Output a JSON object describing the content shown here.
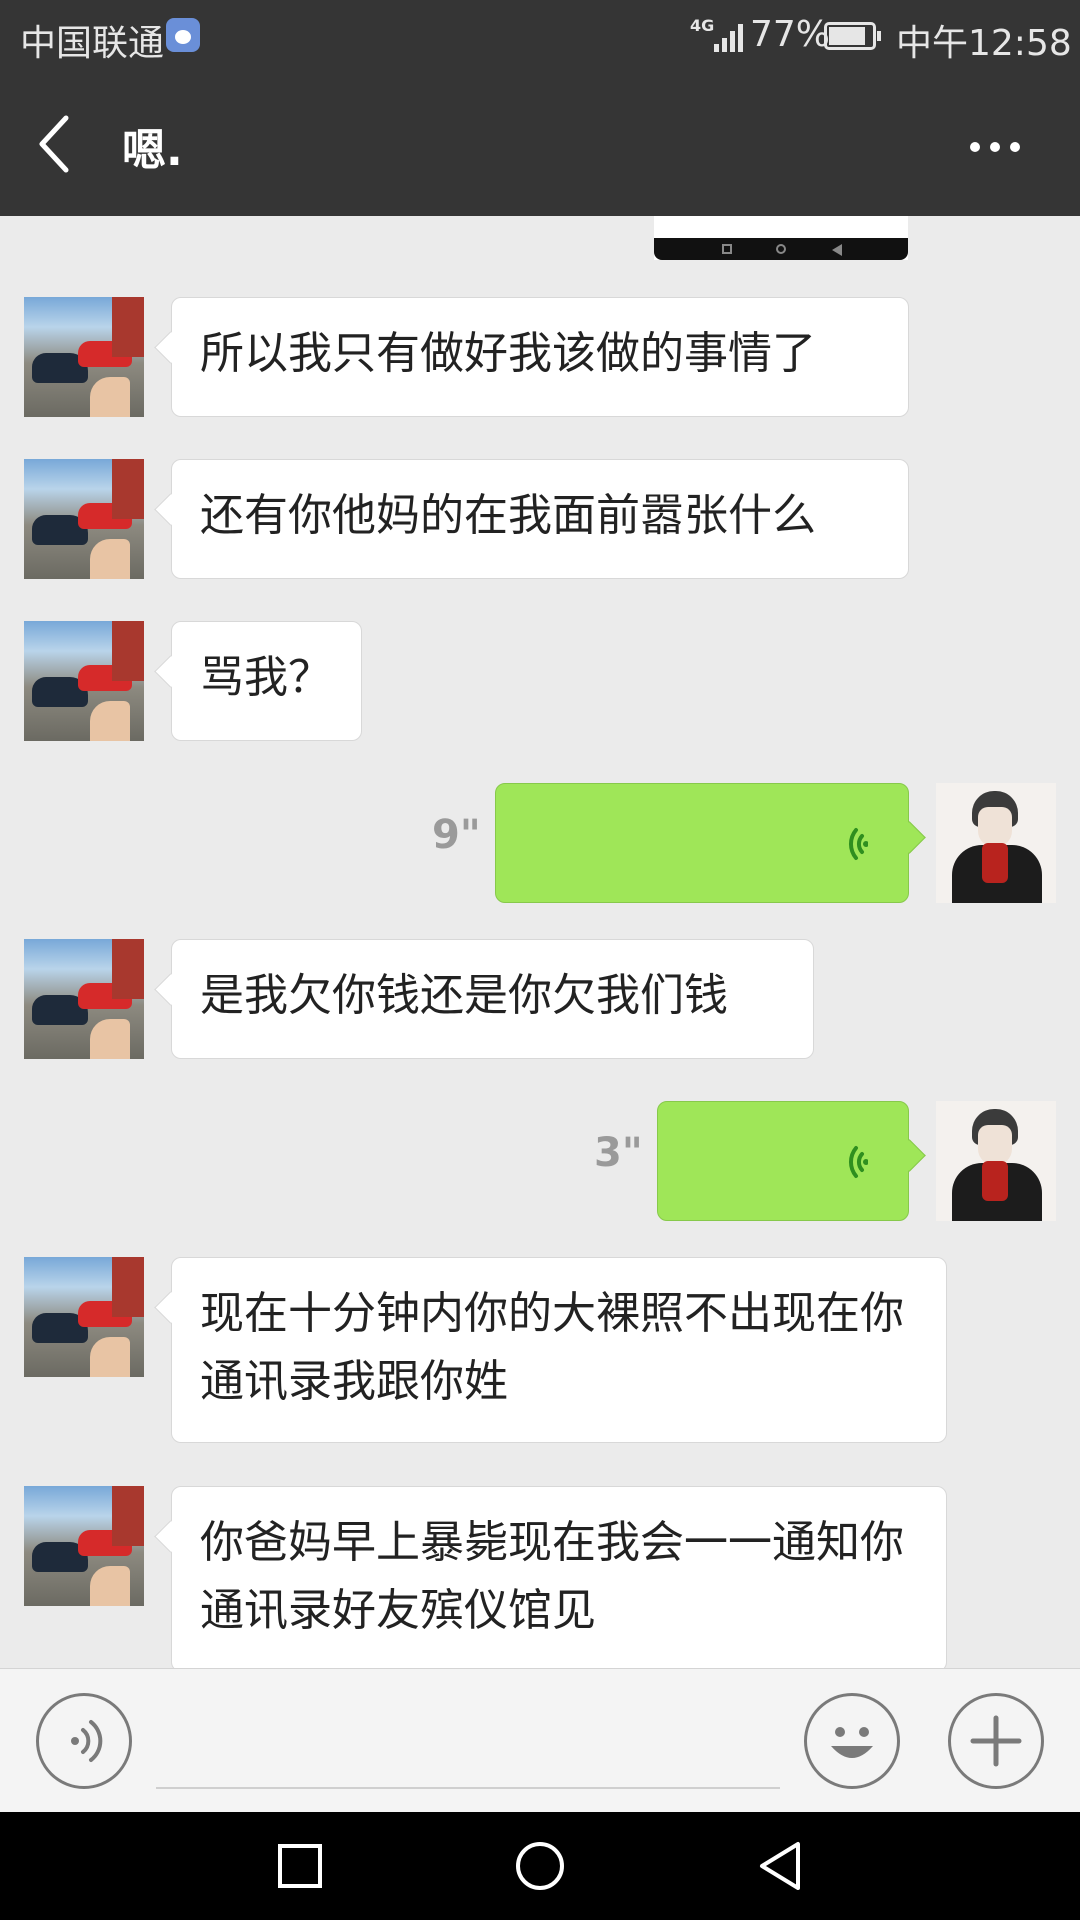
{
  "status_bar": {
    "carrier": "中国联通",
    "network": "4G",
    "battery": "77%",
    "time": "中午12:58"
  },
  "header": {
    "title": "嗯."
  },
  "messages": [
    {
      "side": "left",
      "type": "text",
      "text": "所以我只有做好我该做的事情了"
    },
    {
      "side": "left",
      "type": "text",
      "text": "还有你他妈的在我面前嚣张什么"
    },
    {
      "side": "left",
      "type": "text",
      "text": "骂我？"
    },
    {
      "side": "right",
      "type": "voice",
      "duration": "9\""
    },
    {
      "side": "left",
      "type": "text",
      "text": "是我欠你钱还是你欠我们钱"
    },
    {
      "side": "right",
      "type": "voice",
      "duration": "3\""
    },
    {
      "side": "left",
      "type": "text",
      "text": "现在十分钟内你的大裸照不出现在你通讯录我跟你姓"
    },
    {
      "side": "left",
      "type": "text",
      "text": "你爸妈早上暴毙现在我会一一通知你通讯录好友殡仪馆见"
    }
  ],
  "input_bar": {
    "voice_toggle_icon": "voice-icon",
    "emoji_icon": "emoji-icon",
    "more_icon": "plus-icon"
  },
  "colors": {
    "header_bg": "#353535",
    "chat_bg": "#ebebeb",
    "voice_bubble": "#9fe658"
  }
}
